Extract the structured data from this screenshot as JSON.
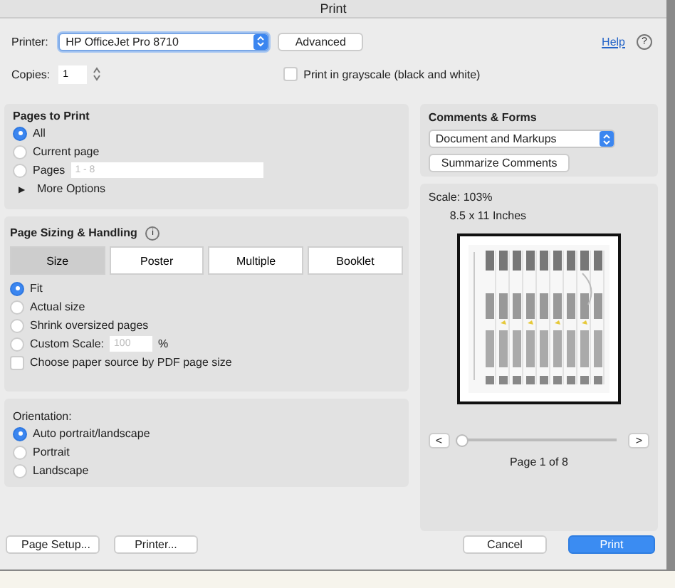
{
  "window": {
    "title": "Print"
  },
  "printer": {
    "label": "Printer:",
    "value": "HP OfficeJet Pro 8710",
    "advanced": "Advanced",
    "help": "Help",
    "help_icon": "?"
  },
  "copies": {
    "label": "Copies:",
    "value": "1"
  },
  "grayscale": {
    "label": "Print in grayscale (black and white)",
    "checked": false
  },
  "pages_to_print": {
    "title": "Pages to Print",
    "options": [
      {
        "label": "All",
        "selected": true
      },
      {
        "label": "Current page",
        "selected": false
      },
      {
        "label": "Pages",
        "selected": false,
        "placeholder": "1 - 8"
      }
    ],
    "more_options": {
      "arrow": "▶",
      "label": "More Options",
      "expanded": false
    }
  },
  "page_sizing": {
    "title": "Page Sizing & Handling",
    "info": "i",
    "tabs": [
      {
        "label": "Size",
        "selected": true
      },
      {
        "label": "Poster",
        "selected": false
      },
      {
        "label": "Multiple",
        "selected": false
      },
      {
        "label": "Booklet",
        "selected": false
      }
    ],
    "options": [
      {
        "label": "Fit",
        "selected": true
      },
      {
        "label": "Actual size",
        "selected": false
      },
      {
        "label": "Shrink oversized pages",
        "selected": false
      },
      {
        "label": "Custom Scale:",
        "selected": false,
        "placeholder": "100",
        "unit": "%"
      }
    ],
    "paper_source": {
      "label": "Choose paper source by PDF page size",
      "checked": false
    }
  },
  "orientation": {
    "title": "Orientation:",
    "options": [
      {
        "label": "Auto portrait/landscape",
        "selected": true
      },
      {
        "label": "Portrait",
        "selected": false
      },
      {
        "label": "Landscape",
        "selected": false
      }
    ]
  },
  "comments_forms": {
    "title": "Comments & Forms",
    "value": "Document and Markups",
    "summarize": "Summarize Comments"
  },
  "preview": {
    "scale": "Scale: 103%",
    "paper": "8.5 x 11 Inches",
    "prev": "<",
    "next": ">",
    "level": 0,
    "page": "Page 1 of 8"
  },
  "buttons": {
    "page_setup": "Page Setup...",
    "printer": "Printer...",
    "cancel": "Cancel",
    "print": "Print"
  }
}
